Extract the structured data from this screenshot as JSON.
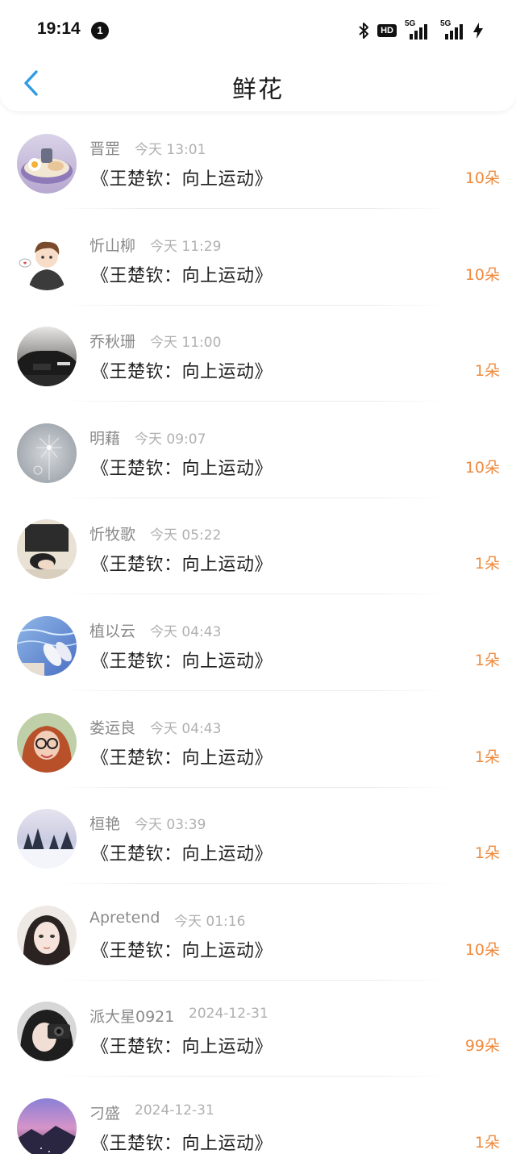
{
  "status": {
    "time": "19:14",
    "notification_count": "1",
    "hd_label": "HD",
    "signal1_label": "5G",
    "signal2_label": "5G"
  },
  "nav": {
    "title": "鲜花"
  },
  "colors": {
    "accent": "#2f9be5",
    "count": "#ef8a3c"
  },
  "items": [
    {
      "name": "晋罡",
      "time": "今天 13:01",
      "title": "《王楚钦：向上运动》",
      "count": "10朵",
      "avatar": "food-bowl-avatar"
    },
    {
      "name": "忻山柳",
      "time": "今天 11:29",
      "title": "《王楚钦：向上运动》",
      "count": "10朵",
      "avatar": "cartoon-boy-avatar"
    },
    {
      "name": "乔秋珊",
      "time": "今天 11:00",
      "title": "《王楚钦：向上运动》",
      "count": "1朵",
      "avatar": "black-car-avatar"
    },
    {
      "name": "明藉",
      "time": "今天 09:07",
      "title": "《王楚钦：向上运动》",
      "count": "10朵",
      "avatar": "dandelion-avatar"
    },
    {
      "name": "忻牧歌",
      "time": "今天 05:22",
      "title": "《王楚钦：向上运动》",
      "count": "1朵",
      "avatar": "sleeping-person-avatar"
    },
    {
      "name": "植以云",
      "time": "今天 04:43",
      "title": "《王楚钦：向上运动》",
      "count": "1朵",
      "avatar": "pool-slippers-avatar"
    },
    {
      "name": "娄运良",
      "time": "今天 04:43",
      "title": "《王楚钦：向上运动》",
      "count": "1朵",
      "avatar": "redhair-girl-avatar"
    },
    {
      "name": "桓艳",
      "time": "今天 03:39",
      "title": "《王楚钦：向上运动》",
      "count": "1朵",
      "avatar": "snowy-forest-avatar"
    },
    {
      "name": "Apretend",
      "time": "今天 01:16",
      "title": "《王楚钦：向上运动》",
      "count": "10朵",
      "avatar": "girl-portrait-avatar"
    },
    {
      "name": "派大星0921",
      "time": "2024-12-31",
      "title": "《王楚钦：向上运动》",
      "count": "99朵",
      "avatar": "camera-girl-avatar"
    },
    {
      "name": "刁盛",
      "time": "2024-12-31",
      "title": "《王楚钦：向上运动》",
      "count": "1朵",
      "avatar": "dusk-mountain-avatar"
    }
  ]
}
